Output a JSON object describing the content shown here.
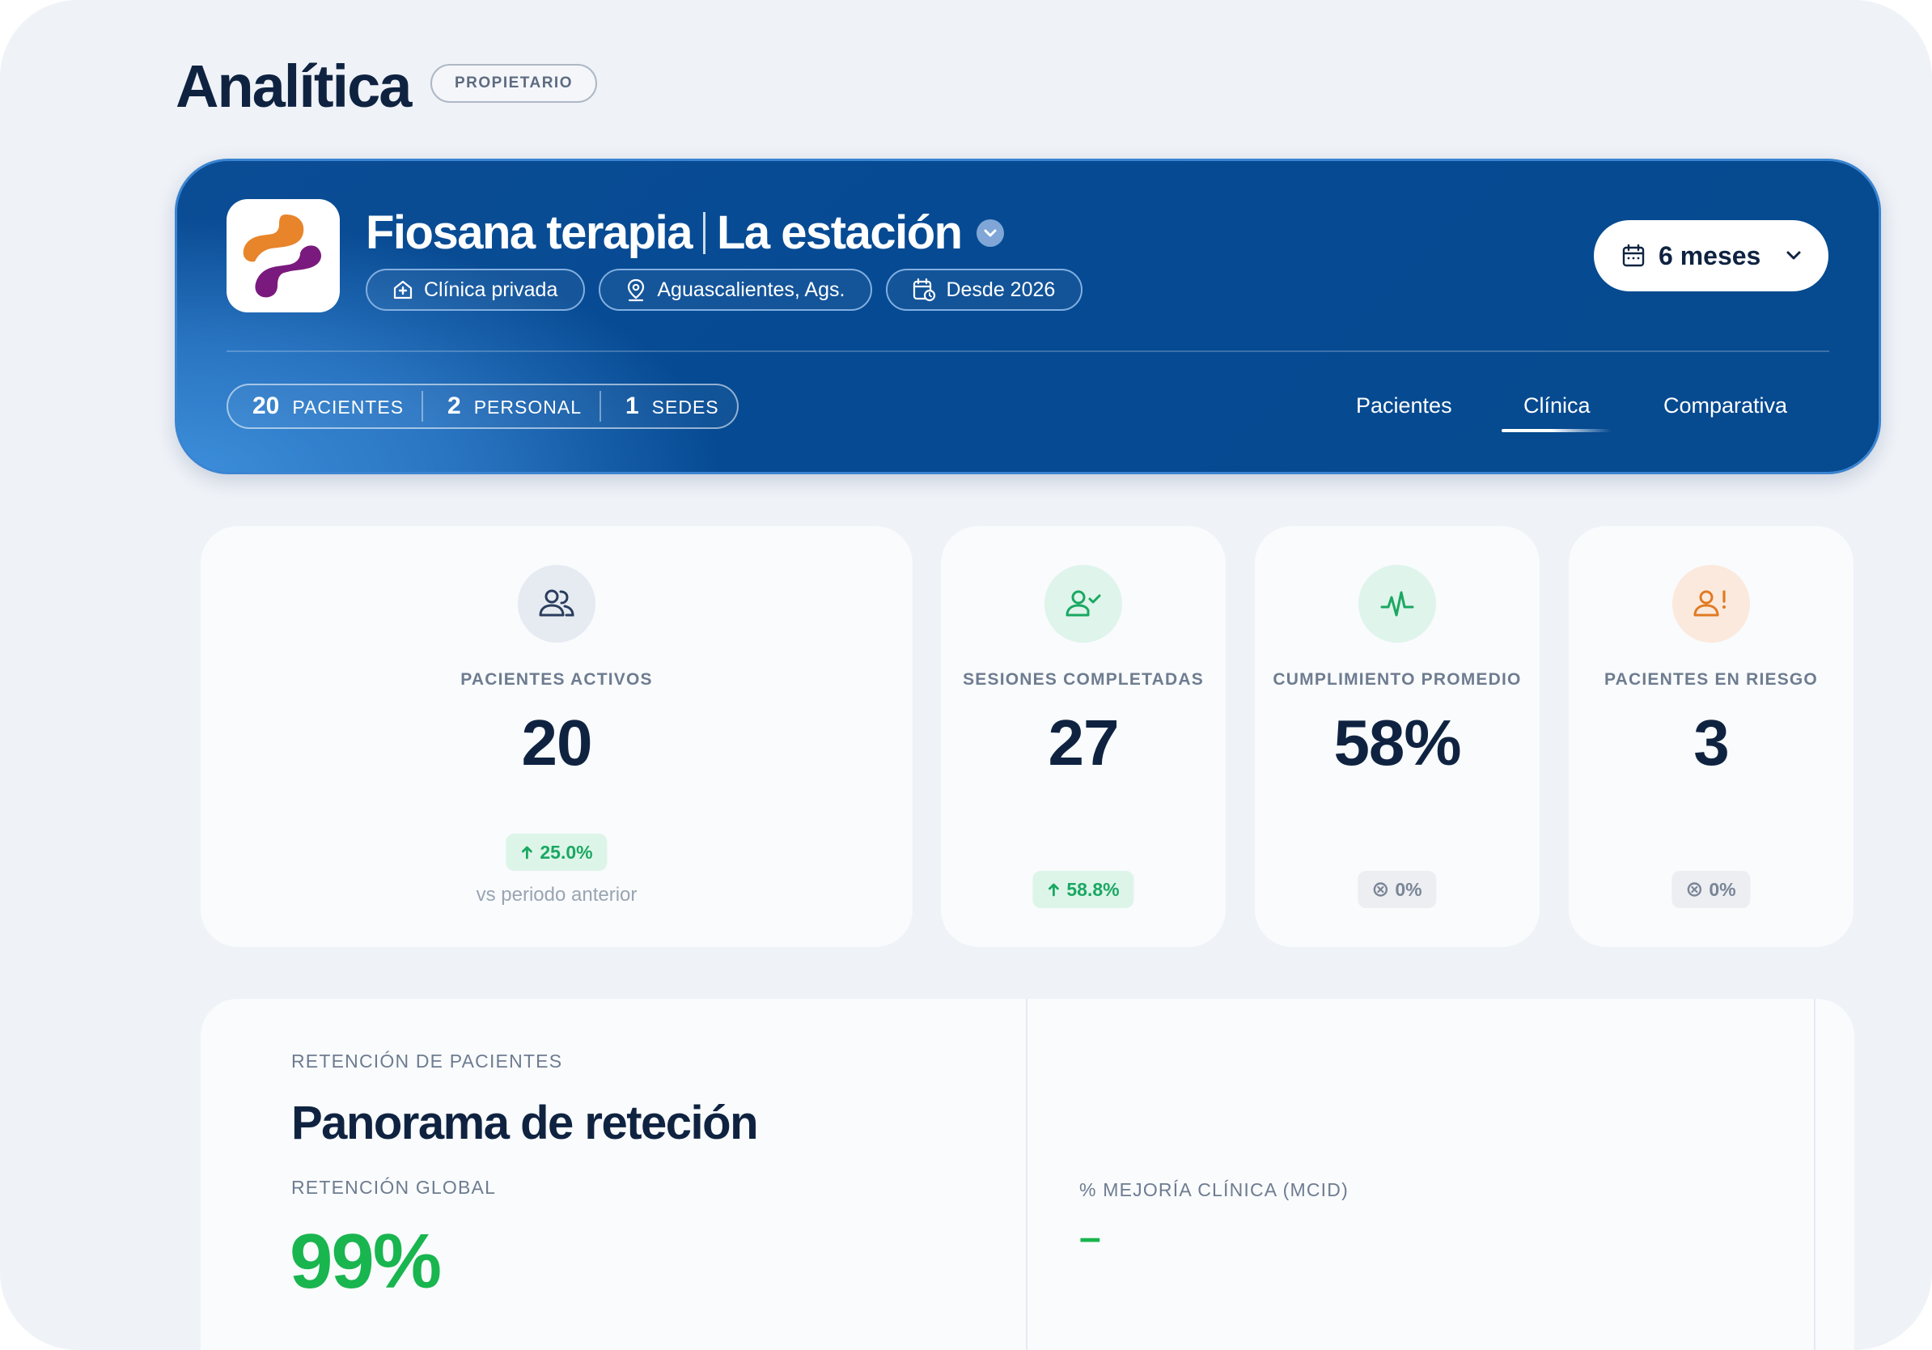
{
  "page": {
    "title": "Analítica",
    "role_badge": "PROPIETARIO"
  },
  "clinic": {
    "name": "Fiosana terapia",
    "branch": "La estación",
    "chips": {
      "type": "Clínica privada",
      "location": "Aguascalientes, Ags.",
      "since": "Desde 2026"
    },
    "logo_colors": {
      "orange": "#e8842a",
      "purple": "#7a1a7e"
    }
  },
  "period_selector": {
    "label": "6 meses"
  },
  "summary": {
    "patients": {
      "count": "20",
      "label": "PACIENTES"
    },
    "staff": {
      "count": "2",
      "label": "PERSONAL"
    },
    "sites": {
      "count": "1",
      "label": "SEDES"
    }
  },
  "tabs": [
    {
      "label": "Pacientes",
      "active": false
    },
    {
      "label": "Clínica",
      "active": true
    },
    {
      "label": "Comparativa",
      "active": false
    }
  ],
  "kpis": [
    {
      "icon": "users-icon",
      "label": "PACIENTES ACTIVOS",
      "value": "20",
      "delta": "25.0%",
      "trend": "up",
      "sub": "vs periodo anterior"
    },
    {
      "icon": "user-check-icon",
      "label": "SESIONES COMPLETADAS",
      "value": "27",
      "delta": "58.8%",
      "trend": "up"
    },
    {
      "icon": "activity-icon",
      "label": "CUMPLIMIENTO PROMEDIO",
      "value": "58%",
      "delta": "0%",
      "trend": "flat"
    },
    {
      "icon": "user-alert-icon",
      "label": "PACIENTES EN RIESGO",
      "value": "3",
      "delta": "0%",
      "trend": "flat"
    }
  ],
  "retention": {
    "kicker": "RETENCIÓN DE PACIENTES",
    "title": "Panorama de reteción",
    "global_label": "RETENCIÓN GLOBAL",
    "global_value": "99%",
    "mcid_label": "% MEJORÍA CLÍNICA (MCID)",
    "mcid_value": "–"
  },
  "colors": {
    "accent_blue": "#054a93",
    "success_green": "#19b54f",
    "text_dark": "#0f2341",
    "muted": "#6e7c90"
  }
}
